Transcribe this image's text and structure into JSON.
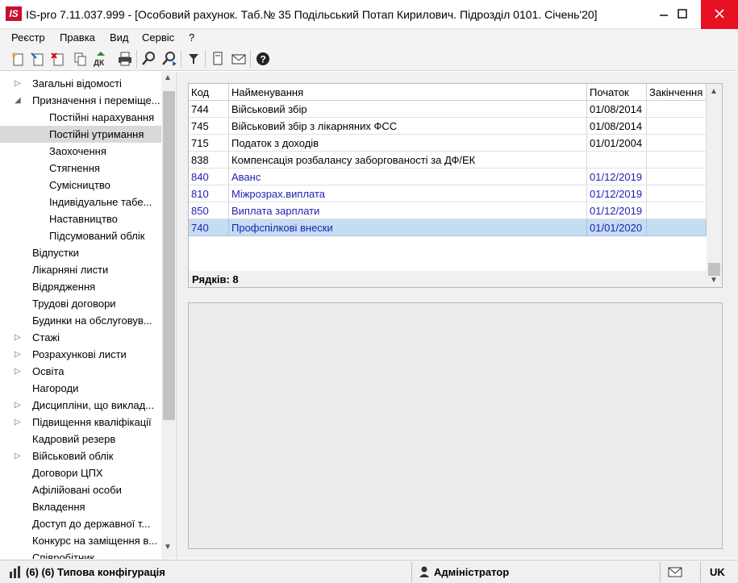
{
  "window": {
    "logo": "IS",
    "title": "IS-pro 7.11.037.999 - [Особовий рахунок. Таб.№ 35 Подільський Потап Кирилович. Підрозділ 0101. Січень'20]",
    "minimize_icon": "–",
    "maximize_icon": "☐",
    "close_icon": "✕"
  },
  "menu": [
    "Реєстр",
    "Правка",
    "Вид",
    "Сервіс",
    "?"
  ],
  "toolbar": {
    "icons": [
      "new-doc-icon",
      "edit-doc-icon",
      "delete-doc-icon",
      "copy-icon",
      "dk-icon",
      "print-icon",
      "search-icon",
      "search-next-icon",
      "filter-icon",
      "card-icon",
      "mail-icon",
      "help-icon"
    ],
    "dk_label": "ДК"
  },
  "tree": {
    "expanded_arrow": "◢",
    "collapsed_arrow": "▷",
    "items": [
      {
        "label": "Загальні відомості"
      },
      {
        "label": "Призначення і переміще..."
      },
      {
        "label": "Постійні нарахування"
      },
      {
        "label": "Постійні утримання"
      },
      {
        "label": "Заохочення"
      },
      {
        "label": "Стягнення"
      },
      {
        "label": "Сумісництво"
      },
      {
        "label": "Індивідуальне табе..."
      },
      {
        "label": "Наставництво"
      },
      {
        "label": "Підсумований облік"
      },
      {
        "label": "Відпустки"
      },
      {
        "label": "Лікарняні листи"
      },
      {
        "label": "Відрядження"
      },
      {
        "label": "Трудові договори"
      },
      {
        "label": "Будинки на обслуговув..."
      },
      {
        "label": "Стажі"
      },
      {
        "label": "Розрахункові листи"
      },
      {
        "label": "Освіта"
      },
      {
        "label": "Нагороди"
      },
      {
        "label": "Дисципліни, що виклад..."
      },
      {
        "label": "Підвищення кваліфікації"
      },
      {
        "label": "Кадровий резерв"
      },
      {
        "label": "Військовий облік"
      },
      {
        "label": "Договори ЦПХ"
      },
      {
        "label": "Афілійовані особи"
      },
      {
        "label": "Вкладення"
      },
      {
        "label": "Доступ до державної т..."
      },
      {
        "label": "Конкурс на заміщення в..."
      },
      {
        "label": "Співробітник"
      }
    ],
    "scroll_up": "▲",
    "scroll_down": "▼"
  },
  "grid": {
    "columns": [
      "Код",
      "Найменування",
      "Початок",
      "Закінчення"
    ],
    "rows": [
      {
        "code": "744",
        "name": "Військовий збір",
        "start": "01/08/2014",
        "end": ""
      },
      {
        "code": "745",
        "name": "Військовий збір з лікарняних ФСС",
        "start": "01/08/2014",
        "end": ""
      },
      {
        "code": "715",
        "name": "Податок з доходів",
        "start": "01/01/2004",
        "end": ""
      },
      {
        "code": "838",
        "name": "Компенсація розбалансу заборгованості за ДФ/ЕК",
        "start": "",
        "end": ""
      },
      {
        "code": "840",
        "name": "Аванс",
        "start": "01/12/2019",
        "end": ""
      },
      {
        "code": "810",
        "name": "Міжрозрах.виплата",
        "start": "01/12/2019",
        "end": ""
      },
      {
        "code": "850",
        "name": "Виплата зарплати",
        "start": "01/12/2019",
        "end": ""
      },
      {
        "code": "740",
        "name": "Профспілкові внески",
        "start": "01/01/2020",
        "end": ""
      }
    ],
    "footer": "Рядків: 8",
    "scroll_up": "▲",
    "scroll_down": "▼"
  },
  "status": {
    "config": "(6) (6) Типова конфігурація",
    "user": "Адміністратор",
    "lang": "UK"
  },
  "colors": {
    "accent_red": "#c8102e",
    "blue_text": "#1f1fb0",
    "selection": "#c5dcf2"
  }
}
